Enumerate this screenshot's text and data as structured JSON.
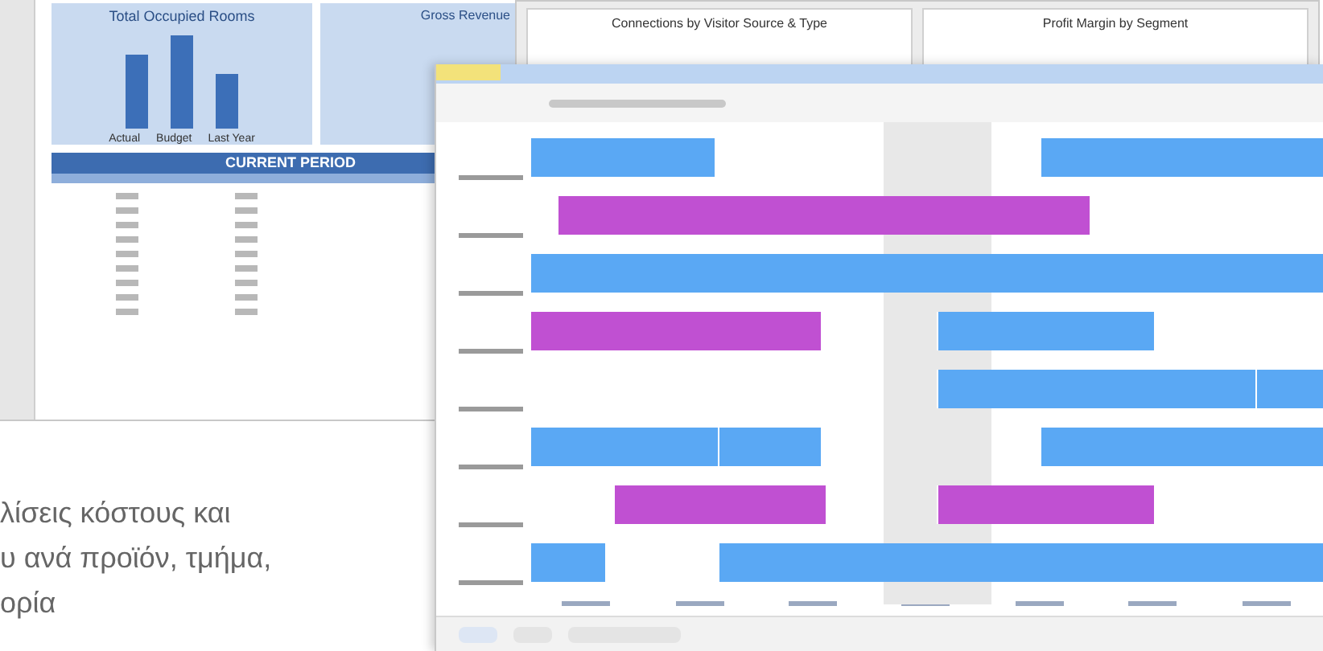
{
  "dashboard": {
    "charts": [
      {
        "title": "Total Occupied Rooms",
        "categories": [
          "Actual",
          "Budget",
          "Last Year"
        ]
      },
      {
        "title": "Gross Revenue"
      }
    ],
    "banner": "CURRENT PERIOD"
  },
  "reports": {
    "charts": [
      {
        "title": "Connections by Visitor Source & Type"
      },
      {
        "title": "Profit Margin by Segment"
      }
    ]
  },
  "scheduler": {
    "rows": [
      {
        "events": [
          {
            "color": "#5aa8f4"
          },
          {
            "color": "#5aa8f4"
          }
        ]
      },
      {
        "events": [
          {
            "color": "#c050d2"
          }
        ]
      },
      {
        "events": [
          {
            "color": "#5aa8f4"
          }
        ]
      },
      {
        "events": [
          {
            "color": "#c050d2"
          },
          {
            "color": "#5aa8f4"
          }
        ]
      },
      {
        "events": [
          {
            "color": "#5aa8f4"
          },
          {
            "color": "#5aa8f4"
          }
        ]
      },
      {
        "events": [
          {
            "color": "#5aa8f4"
          },
          {
            "color": "#5aa8f4"
          },
          {
            "color": "#5aa8f4"
          }
        ]
      },
      {
        "events": [
          {
            "color": "#c050d2"
          },
          {
            "color": "#c050d2"
          }
        ]
      },
      {
        "events": [
          {
            "color": "#5aa8f4"
          },
          {
            "color": "#5aa8f4"
          }
        ]
      }
    ]
  },
  "caption": [
    "λίσεις κόστους και",
    "υ ανά προϊόν, τμήμα,",
    "ορία"
  ]
}
